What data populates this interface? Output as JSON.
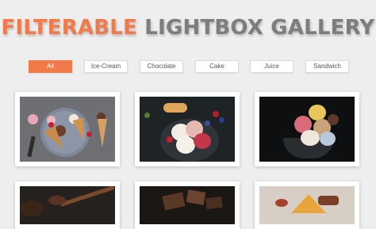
{
  "header": {
    "title_accent": "FILTERABLE",
    "title_rest": "LIGHTBOX GALLERY"
  },
  "filters": [
    {
      "label": "All",
      "active": true
    },
    {
      "label": "Ice-Cream",
      "active": false
    },
    {
      "label": "Chocolate",
      "active": false
    },
    {
      "label": "Cake",
      "active": false
    },
    {
      "label": "Juice",
      "active": false
    },
    {
      "label": "Sandwich",
      "active": false
    }
  ],
  "colors": {
    "accent": "#f07a4a",
    "title_gray": "#7d7d7d",
    "background": "#eeeeee"
  },
  "gallery": [
    {
      "subject": "ice-cream-cones-plate"
    },
    {
      "subject": "ice-cream-bowl-berries"
    },
    {
      "subject": "ice-cream-scoops-dark"
    },
    {
      "subject": "chocolate-spoon"
    },
    {
      "subject": "chocolate-pieces"
    },
    {
      "subject": "cake-slice"
    }
  ]
}
